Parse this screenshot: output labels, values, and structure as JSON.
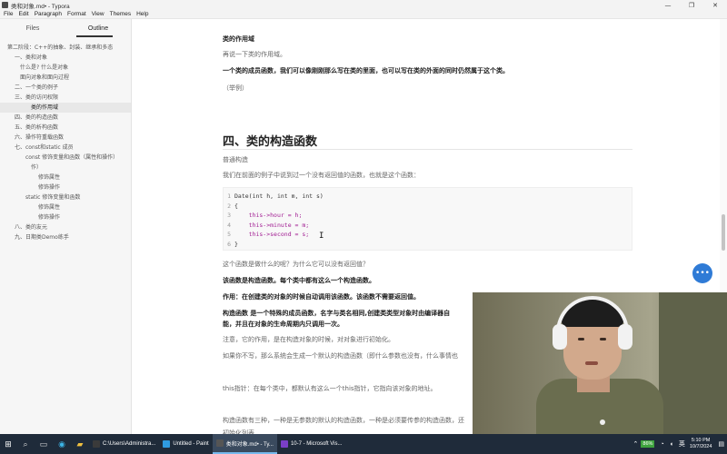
{
  "window": {
    "title": "类和对象.md• - Typora",
    "controls": [
      "—",
      "❐",
      "✕"
    ]
  },
  "menu": [
    "File",
    "Edit",
    "Paragraph",
    "Format",
    "View",
    "Themes",
    "Help"
  ],
  "sidebar": {
    "tabs": [
      "Files",
      "Outline"
    ],
    "active_tab": "Outline",
    "outline": [
      {
        "label": "第二阶段：C++的抽象、封装、继承和多态",
        "indent": 8
      },
      {
        "label": "一、类和对象",
        "indent": 16
      },
      {
        "label": "什么是?  什么是对象",
        "indent": 22
      },
      {
        "label": "面向对象和面向过程",
        "indent": 22
      },
      {
        "label": "二、一个类的例子",
        "indent": 16
      },
      {
        "label": "三、类的访问权限",
        "indent": 16
      },
      {
        "label": "类的作用域",
        "indent": 34,
        "active": true
      },
      {
        "label": "四、类的构造函数",
        "indent": 16
      },
      {
        "label": "五、类的析构函数",
        "indent": 16
      },
      {
        "label": "六、操作符重载函数",
        "indent": 16
      },
      {
        "label": "七、const和static 成员",
        "indent": 16
      },
      {
        "label": "const 修饰变量和函数（属性和操作）",
        "indent": 28
      },
      {
        "label": "作）",
        "indent": 34
      },
      {
        "label": "修饰属性",
        "indent": 42
      },
      {
        "label": "修饰操作",
        "indent": 42
      },
      {
        "label": "static 修饰变量和函数",
        "indent": 28
      },
      {
        "label": "修饰属性",
        "indent": 42
      },
      {
        "label": "修饰操作",
        "indent": 42
      },
      {
        "label": "八、类的友元",
        "indent": 16
      },
      {
        "label": "九、日期类Demo练手",
        "indent": 16
      }
    ],
    "footer": [
      "<",
      "</>"
    ]
  },
  "doc": {
    "scope_heading": "类的作用域",
    "p1": "再说一下类的作用域。",
    "p2": "一个类的成员函数，我们可以像刚刚那么写在类的里面，也可以写在类的外面的同时仍然属于这个类。",
    "p3": "（举例）",
    "h2": "四、类的构造函数",
    "p4": "普通构造",
    "p5": "我们在前面的例子中说到过一个没有返回值的函数，也就是这个函数：",
    "code": [
      {
        "n": "1",
        "t": "Date(int h, int m, int s)"
      },
      {
        "n": "2",
        "t": "{"
      },
      {
        "n": "3",
        "t": "    this->hour = h;"
      },
      {
        "n": "4",
        "t": "    this->minute = m;"
      },
      {
        "n": "5",
        "t": "    this->second = s;"
      },
      {
        "n": "6",
        "t": "}"
      }
    ],
    "p6": "这个函数是做什么的呢？为什么它可以没有返回值？",
    "p7": "该函数是构造函数。每个类中都有这么一个构造函数。",
    "p8": "作用：在创建类的对象的时候自动调用该函数。该函数不需要返回值。",
    "p9": "构造函数    是一个特殊的成员函数，名字与类名相同,创建类类型对象时由编译器自",
    "p10": "能，并且在对象的生命周期内只调用一次。",
    "p11": "注意，它的作用，是在构造对象的时候，对对象进行初始化。",
    "p12": "如果你不写，那么系统会生成一个默认的构造函数（即什么参数也没有，什么事情也",
    "p13": "this指针：在每个类中，都默认有这么一个this指针，它指向该对象的地址。",
    "p14": "构造函数有三种，一种是无参数的默认的构造函数，一种是必须要传参的构造函数，还",
    "p15": "初始化列表"
  },
  "taskbar": {
    "tasks": [
      {
        "label": "C:\\Users\\Administra...",
        "color": "#3a3a3a"
      },
      {
        "label": "Untitled - Paint",
        "color": "#2f9be0"
      },
      {
        "label": "类和对象.md• - Ty...",
        "color": "#555555",
        "active": true
      },
      {
        "label": "10-7 - Microsoft Vis...",
        "color": "#7a3fc7"
      }
    ],
    "battery": "86%",
    "ime": "英",
    "time": "5:10 PM",
    "date": "10/7/2024"
  },
  "colors": {
    "accent": "#2f7bd6",
    "taskbar": "#1f2b3a",
    "code_this": "#a01a91",
    "code_type": "#7a3e9d"
  }
}
